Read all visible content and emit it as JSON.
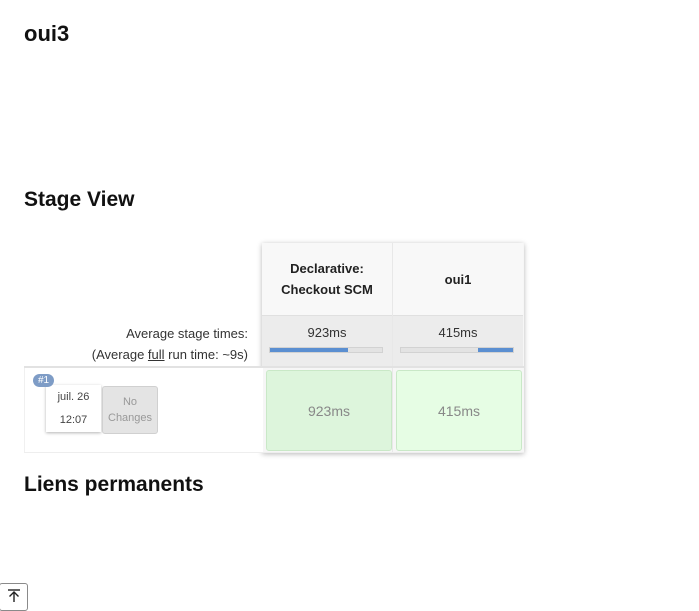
{
  "page": {
    "title": "oui3"
  },
  "stage_view": {
    "heading": "Stage View",
    "columns": [
      {
        "name_line1": "Declarative:",
        "name_line2": "Checkout SCM",
        "avg_time": "923ms",
        "bar_fill_pct": 70
      },
      {
        "name_line1": "oui1",
        "name_line2": "",
        "avg_time": "415ms",
        "bar_fill_pct": 31
      }
    ],
    "avg_label": {
      "line1": "Average stage times:",
      "line2_prefix": "(Average ",
      "line2_link": "full",
      "line2_suffix": " run time: ~9s)"
    },
    "runs": [
      {
        "badge": "#1",
        "date": "juil. 26",
        "time": "12:07",
        "changes": "No Changes",
        "cells": [
          "923ms",
          "415ms"
        ]
      }
    ]
  },
  "permalinks": {
    "heading": "Liens permanents"
  },
  "icons": {
    "scroll_top": "arrow-to-top-icon"
  },
  "colors": {
    "bar": "#5b8fd1",
    "success_cell": "#ddf5dc",
    "badge": "#7e9cc6"
  }
}
